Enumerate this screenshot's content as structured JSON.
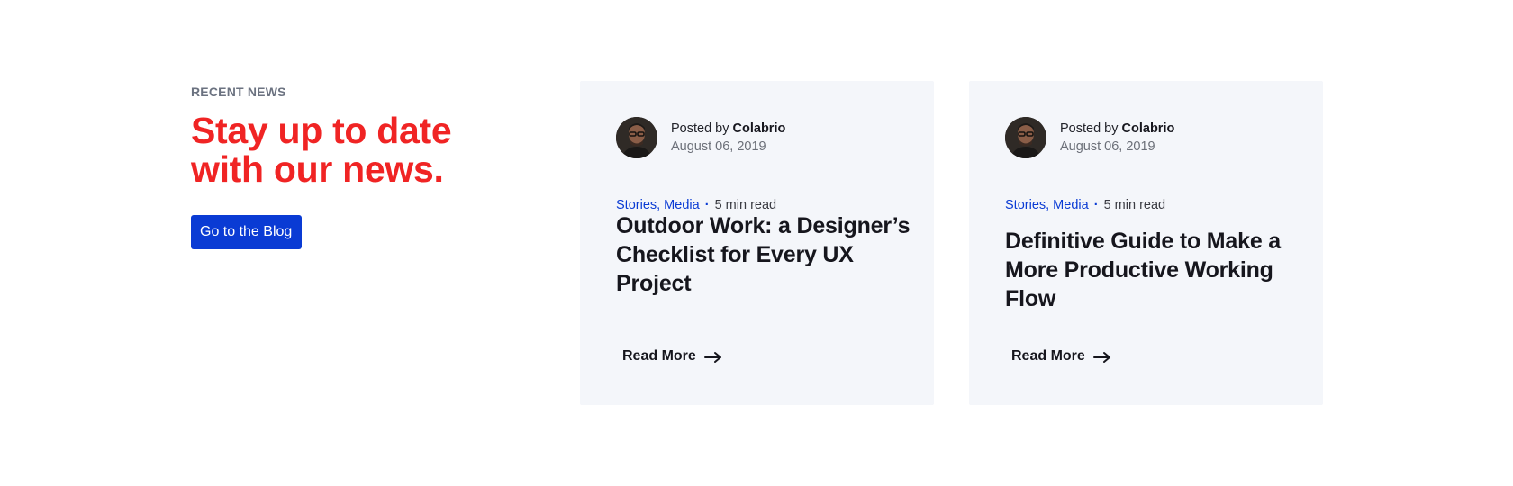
{
  "intro": {
    "eyebrow": "RECENT NEWS",
    "headline_line1": "Stay up to date",
    "headline_line2": "with our news.",
    "button_label": "Go to the Blog"
  },
  "cards": [
    {
      "posted_prefix": "Posted by",
      "author": "Colabrio",
      "date": "August 06, 2019",
      "tags": "Stories, Media",
      "separator": "·",
      "read_time": "5 min read",
      "title": "Outdoor Work: a Designer’s Checklist for Every UX Project",
      "read_more": "Read More",
      "avatar_icon": "avatar-photo",
      "arrow_icon": "arrow-right-icon"
    },
    {
      "posted_prefix": "Posted by",
      "author": "Colabrio",
      "date": "August 06, 2019",
      "tags": "Stories, Media",
      "separator": "·",
      "read_time": "5 min read",
      "title": "Definitive Guide to Make a More Productive Working Flow",
      "read_more": "Read More",
      "avatar_icon": "avatar-photo",
      "arrow_icon": "arrow-right-icon"
    }
  ],
  "colors": {
    "accent_red": "#f02424",
    "brand_blue": "#0a3bd4",
    "card_bg": "#f4f6fa",
    "text_dark": "#16161d"
  }
}
